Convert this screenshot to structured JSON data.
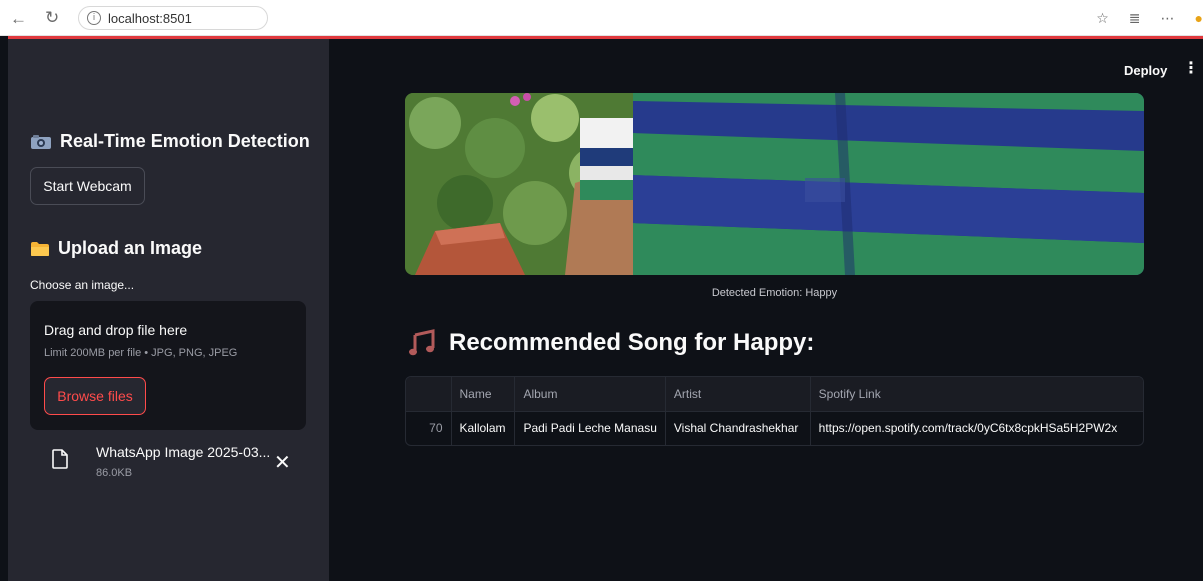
{
  "browser": {
    "url": "localhost:8501",
    "nav_icons": [
      "back-arrow-icon",
      "reload-icon",
      "info-icon"
    ],
    "tool_icons": [
      "favorite-star-icon",
      "collections-icon",
      "more-icon"
    ]
  },
  "header": {
    "deploy_label": "Deploy",
    "menu_glyph": "⋮"
  },
  "sidebar": {
    "webcam_title": "Real-Time Emotion Detection",
    "webcam_button": "Start Webcam",
    "upload_title": "Upload an Image",
    "uploader_label": "Choose an image...",
    "dropzone_title": "Drag and drop file here",
    "dropzone_limit": "Limit 200MB per file • JPG, PNG, JPEG",
    "browse_button": "Browse files",
    "uploaded_file": {
      "name": "WhatsApp Image 2025-03...",
      "size": "86.0KB",
      "remove_glyph": "✕"
    }
  },
  "main": {
    "image_caption": "Detected Emotion: Happy",
    "section_title": "Recommended Song for Happy:",
    "table": {
      "columns": [
        "",
        "Name",
        "Album",
        "Artist",
        "Spotify Link"
      ],
      "rows": [
        {
          "index": "70",
          "name": "Kallolam",
          "album": "Padi Padi Leche Manasu",
          "artist": "Vishal Chandrashekhar",
          "spotify_link": "https://open.spotify.com/track/0yC6tx8cpkHSa5H2PW2x"
        }
      ]
    }
  },
  "colors": {
    "accent": "#ff4b4b",
    "sidebar_bg": "#262730",
    "main_bg": "#0e1117",
    "stripe_green": "#2f8a5b",
    "stripe_navy": "#263a8c"
  }
}
